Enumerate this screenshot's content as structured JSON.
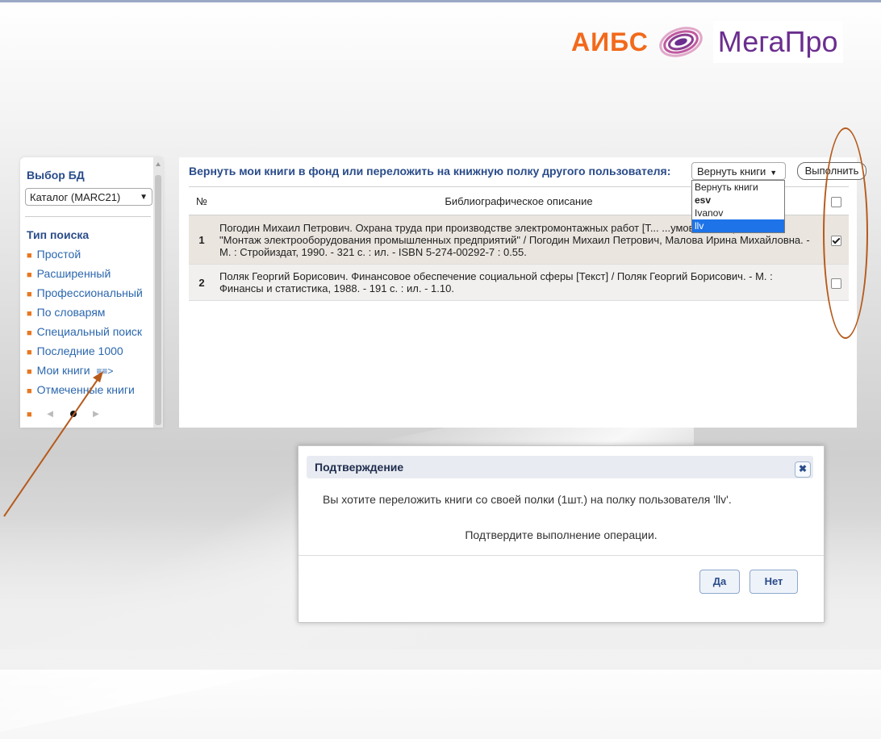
{
  "logo": {
    "aibs": "АИБС",
    "mega": "МегаПро"
  },
  "sidebar": {
    "db_title": "Выбор БД",
    "db_select": "Каталог (MARC21)",
    "search_type_title": "Тип поиска",
    "items": [
      {
        "label": "Простой"
      },
      {
        "label": "Расширенный"
      },
      {
        "label": "Профессиональный"
      },
      {
        "label": "По словарям"
      },
      {
        "label": "Специальный поиск"
      },
      {
        "label": "Последние 1000"
      },
      {
        "label": "Мои книги",
        "suffix": "≡≡>"
      },
      {
        "label": "Отмеченные книги"
      }
    ],
    "pager": {
      "prev": "◄",
      "next": "►"
    }
  },
  "main": {
    "title": "Вернуть мои книги в фонд или переложить на книжную полку другого пользователя:",
    "action_select": "Вернуть книги",
    "execute_label": "Выполнить",
    "dropdown_options": [
      {
        "label": "Вернуть книги",
        "style": "normal"
      },
      {
        "label": "esv",
        "style": "bold"
      },
      {
        "label": "Ivanov",
        "style": "normal"
      },
      {
        "label": "llv",
        "style": "selected"
      }
    ],
    "table": {
      "col_num": "№",
      "col_desc": "Библиографическое описание",
      "rows": [
        {
          "num": "1",
          "desc": "Погодин Михаил Петрович. Охрана труда при производстве электромонтажных работ [Т... ...умов по специальности \"Монтаж электрооборудования промышленных предприятий\" / Погодин Михаил Петрович, Малова Ирина Михайловна. - М. : Стройиздат, 1990. - 321 с. : ил. - ISBN 5-274-00292-7 : 0.55.",
          "checked": true
        },
        {
          "num": "2",
          "desc": "Поляк Георгий Борисович. Финансовое обеспечение социальной сферы [Текст] / Поляк Георгий Борисович. - М. : Финансы и статистика, 1988. - 191 с. : ил. - 1.10.",
          "checked": false
        }
      ]
    }
  },
  "dialog": {
    "title": "Подтверждение",
    "close": "✖",
    "message": "Вы хотите переложить книги со своей полки (1шт.) на полку пользователя 'llv'.",
    "confirm": "Подтвердите выполнение операции.",
    "yes": "Да",
    "no": "Нет"
  },
  "colors": {
    "accent_orange": "#f26a1b",
    "brand_purple": "#6b2e8f",
    "link_blue": "#2b67ae",
    "annotation": "#b65a1c"
  }
}
